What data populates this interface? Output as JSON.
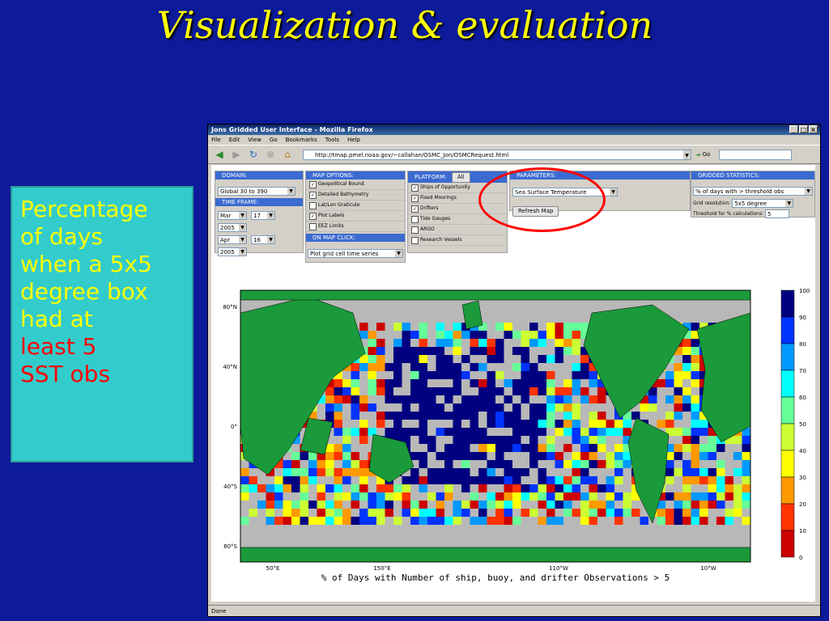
{
  "slide": {
    "title": "Visualization & evaluation",
    "callout_lines": [
      "Percentage",
      "of days",
      "when a 5x5",
      "degree box",
      "had at"
    ],
    "callout_red_lines": [
      "least 5",
      "SST obs"
    ]
  },
  "browser": {
    "title": "Jons Gridded User Interface - Mozilla Firefox",
    "menu": [
      "File",
      "Edit",
      "View",
      "Go",
      "Bookmarks",
      "Tools",
      "Help"
    ],
    "url": "http://tmap.pmel.noaa.gov/~callahan/OSMC_Jon/OSMCRequest.html",
    "go_label": "Go",
    "status": "Done"
  },
  "form": {
    "domain": {
      "header": "DOMAIN:",
      "value": "Global 30 to 390"
    },
    "timeframe": {
      "header": "TIME FRAME:",
      "from_month": "Mar",
      "from_day": "17",
      "from_year": "2005",
      "to_month": "Apr",
      "to_day": "16",
      "to_year": "2005"
    },
    "map_options": {
      "header": "MAP OPTIONS:",
      "items": [
        {
          "label": "Geopolitical Bound.",
          "checked": true
        },
        {
          "label": "Detailed Bathymetry",
          "checked": true
        },
        {
          "label": "Lat/Lon Graticule",
          "checked": false
        },
        {
          "label": "Plot Labels",
          "checked": true
        },
        {
          "label": "EEZ Limits",
          "checked": false
        }
      ]
    },
    "on_map_click": {
      "header": "ON MAP CLICK:",
      "value": "Plot grid cell time series"
    },
    "platform": {
      "header": "PLATFORM:",
      "all_button": "All",
      "items": [
        {
          "label": "Ships of Opportunity",
          "checked": true
        },
        {
          "label": "Fixed Moorings",
          "checked": true
        },
        {
          "label": "Drifters",
          "checked": true
        },
        {
          "label": "Tide Gauges",
          "checked": false
        },
        {
          "label": "ARGO",
          "checked": false
        },
        {
          "label": "Research Vessels",
          "checked": false
        }
      ]
    },
    "parameters": {
      "header": "PARAMETERS:",
      "value": "Sea Surface Temperature",
      "refresh_button": "Refresh Map"
    },
    "gridded_stats": {
      "header": "GRIDDED STATISTICS:",
      "value": "% of days with > threshold obs",
      "resolution_label": "Grid resolution:",
      "resolution_value": "5x5 degree",
      "threshold_label": "Threshold for % calculations:",
      "threshold_value": "5"
    }
  },
  "map": {
    "caption": "% of Days with Number of ship, buoy, and drifter Observations > 5",
    "lat_labels": [
      "80°N",
      "40°N",
      "0°",
      "40°S",
      "80°S"
    ],
    "lon_labels": [
      "50°E",
      "150°E",
      "110°W",
      "10°W"
    ],
    "colorbar_labels": [
      "100",
      "90",
      "80",
      "70",
      "60",
      "50",
      "40",
      "30",
      "20",
      "10",
      "0"
    ],
    "colorbar_colors": [
      "#000080",
      "#0033ff",
      "#0099ff",
      "#00ffff",
      "#66ff99",
      "#ccff33",
      "#ffff00",
      "#ff9900",
      "#ff3300",
      "#cc0000"
    ]
  }
}
